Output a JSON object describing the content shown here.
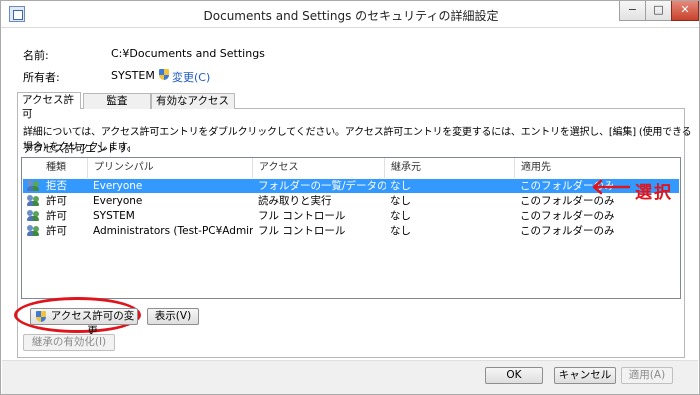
{
  "window": {
    "title": "Documents and Settings のセキュリティの詳細設定",
    "buttons": [
      "−",
      "□",
      "✕"
    ]
  },
  "info": {
    "name_label": "名前:",
    "name_value": "C:¥Documents and Settings",
    "owner_label": "所有者:",
    "owner_value": "SYSTEM",
    "change_link": "変更(C)"
  },
  "tabs": [
    "アクセス許可",
    "監査",
    "有効なアクセス"
  ],
  "description": "詳細については、アクセス許可エントリをダブルクリックしてください。アクセス許可エントリを変更するには、エントリを選択し、[編集] (使用できる場合) をクリックします。",
  "entries_label": "アクセス許可エントリ:",
  "table": {
    "columns": [
      "種類",
      "プリンシパル",
      "アクセス",
      "継承元",
      "適用先"
    ],
    "rows": [
      [
        "拒否",
        "Everyone",
        "フォルダーの一覧/データの読み...",
        "なし",
        "このフォルダーのみ"
      ],
      [
        "許可",
        "Everyone",
        "読み取りと実行",
        "なし",
        "このフォルダーのみ"
      ],
      [
        "許可",
        "SYSTEM",
        "フル コントロール",
        "なし",
        "このフォルダーのみ"
      ],
      [
        "許可",
        "Administrators (Test-PC¥Admini...",
        "フル コントロール",
        "なし",
        "このフォルダーのみ"
      ]
    ],
    "selected_index": 0
  },
  "buttons": {
    "change_permissions": "アクセス許可の変更",
    "show": "表示(V)",
    "enable_inheritance": "継承の有効化(I)",
    "ok": "OK",
    "cancel": "キャンセル",
    "apply": "適用(A)"
  },
  "annotation": {
    "text": "選択",
    "color": "#e0141c"
  }
}
